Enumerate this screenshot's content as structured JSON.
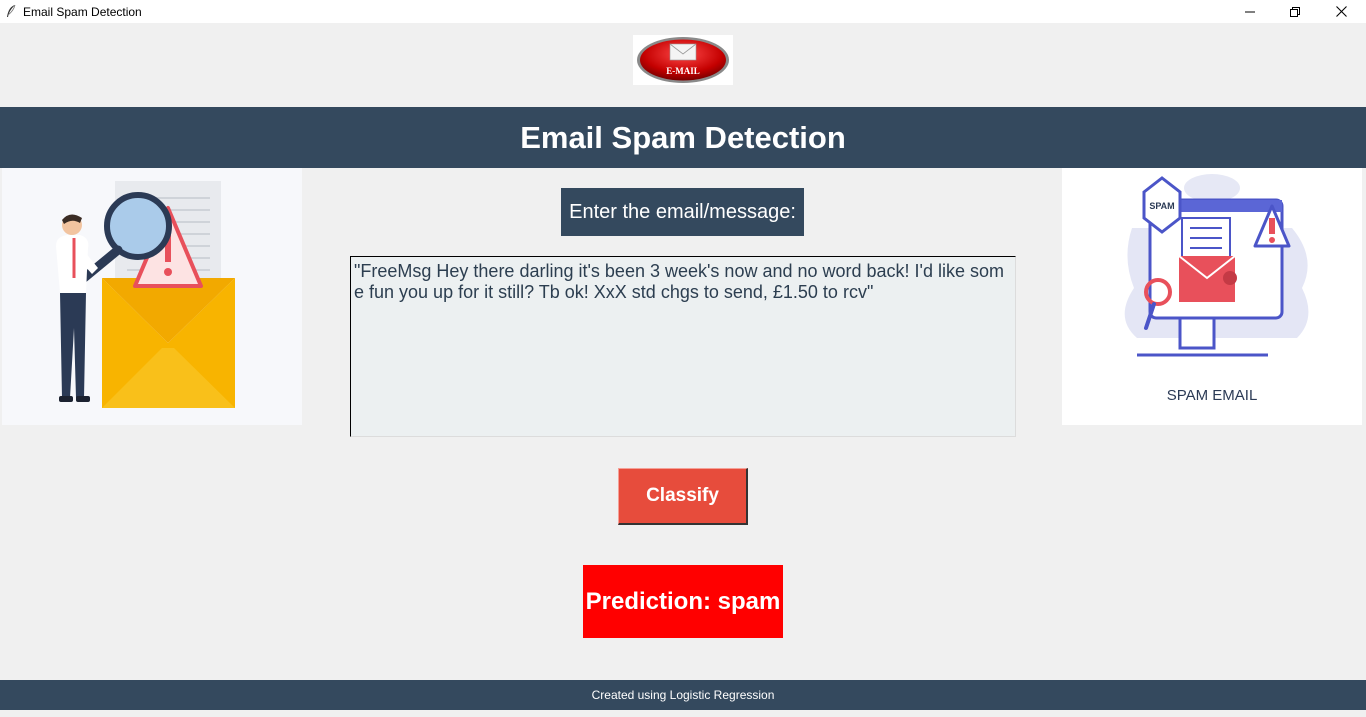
{
  "window": {
    "title": "Email Spam Detection",
    "controls": [
      "minimize-icon",
      "restore-icon",
      "close-icon"
    ]
  },
  "logo": {
    "icon": "email-logo-icon",
    "text": "E-MAIL"
  },
  "header": {
    "title": "Email Spam Detection"
  },
  "left_image": {
    "icon": "investigator-envelope-illustration"
  },
  "right_image": {
    "icon": "spam-computer-illustration",
    "caption": "SPAM EMAIL",
    "badge": "SPAM"
  },
  "input": {
    "label": "Enter the email/message:",
    "value": "\"FreeMsg Hey there darling it's been 3 week's now and no word back! I'd like some fun you up for it still? Tb ok! XxX std chgs to send, £1.50 to rcv\""
  },
  "actions": {
    "classify_label": "Classify"
  },
  "result": {
    "text": "Prediction: spam",
    "color": "#ff0000"
  },
  "footer": {
    "text": "Created using Logistic Regression"
  },
  "colors": {
    "header_bg": "#34495e",
    "button_bg": "#e74c3c",
    "textarea_bg": "#ecf0f1",
    "window_bg": "#f0f0f0"
  }
}
